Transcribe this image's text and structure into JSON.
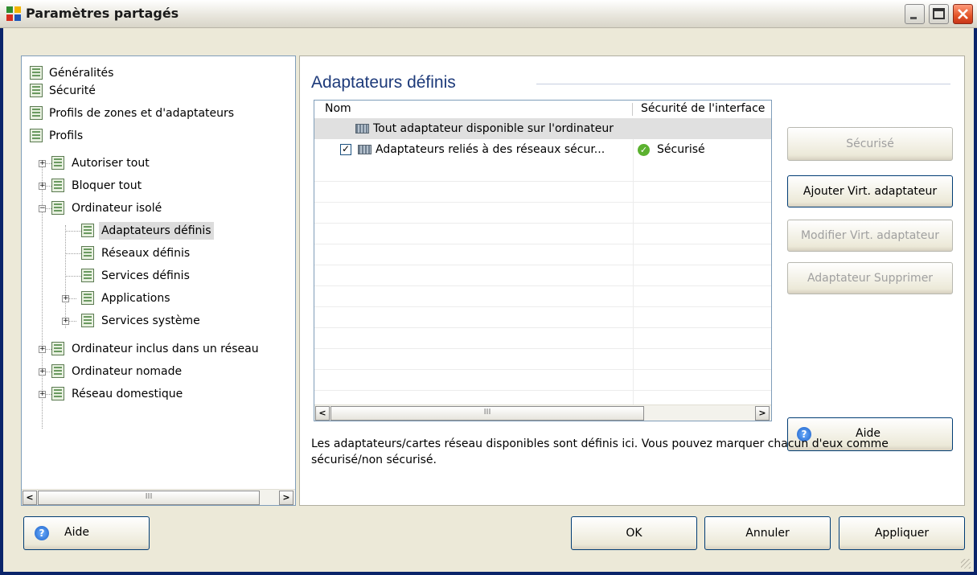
{
  "window": {
    "title": "Paramètres partagés"
  },
  "tree": {
    "items": [
      {
        "label": "Généralités"
      },
      {
        "label": "Sécurité"
      },
      {
        "label": "Profils de zones et d'adaptateurs"
      },
      {
        "label": "Profils"
      },
      {
        "label": "Autoriser tout"
      },
      {
        "label": "Bloquer tout"
      },
      {
        "label": "Ordinateur isolé"
      },
      {
        "label": "Adaptateurs définis"
      },
      {
        "label": "Réseaux définis"
      },
      {
        "label": "Services définis"
      },
      {
        "label": "Applications"
      },
      {
        "label": "Services système"
      },
      {
        "label": "Ordinateur inclus dans un réseau"
      },
      {
        "label": "Ordinateur nomade"
      },
      {
        "label": "Réseau domestique"
      }
    ],
    "scroll_thumb_glyph": "III"
  },
  "main": {
    "section_title": "Adaptateurs définis",
    "list": {
      "columns": [
        "Nom",
        "Sécurité de l'interface"
      ],
      "rows": [
        {
          "name": "Tout adaptateur disponible sur l'ordinateur",
          "security": "",
          "checked": null
        },
        {
          "name": "Adaptateurs reliés à des réseaux sécur...",
          "security": "Sécurisé",
          "checked": true
        }
      ],
      "scroll_thumb_glyph": "III"
    },
    "buttons": {
      "securise": "Sécurisé",
      "ajouter": "Ajouter Virt. adaptateur",
      "modifier": "Modifier Virt. adaptateur",
      "supprimer": "Adaptateur Supprimer",
      "aide": "Aide"
    },
    "description": "Les adaptateurs/cartes réseau disponibles sont définis ici. Vous pouvez marquer chacun d'eux comme sécurisé/non sécurisé."
  },
  "footer": {
    "aide": "Aide",
    "ok": "OK",
    "annuler": "Annuler",
    "appliquer": "Appliquer"
  },
  "glyphs": {
    "check": "✓",
    "checkbox": "✓",
    "minimize": "_",
    "maximize": "□",
    "close": "✕",
    "arrow_left": "<",
    "arrow_right": ">",
    "plus": "+",
    "minus": "−",
    "help": "?"
  },
  "colors": {
    "title_blue": "#1d3a7a",
    "secure_green": "#5bb12f",
    "close_red": "#e25427"
  }
}
